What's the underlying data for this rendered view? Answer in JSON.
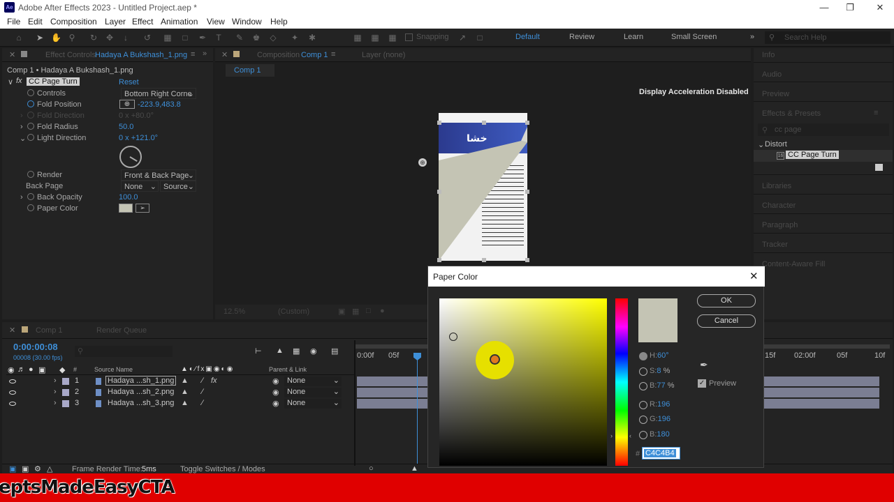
{
  "app": {
    "title": "Adobe After Effects 2023 - Untitled Project.aep *",
    "logo": "Ae"
  },
  "menu": [
    "File",
    "Edit",
    "Composition",
    "Layer",
    "Effect",
    "Animation",
    "View",
    "Window",
    "Help"
  ],
  "toolbar": {
    "snapping": "Snapping",
    "workspaces": [
      "Default",
      "Review",
      "Learn",
      "Small Screen"
    ],
    "search_placeholder": "Search Help"
  },
  "effect_controls": {
    "tab_prefix": "Effect Controls",
    "tab_name": "Hadaya A Bukshash_1.png",
    "breadcrumb": "Comp 1 • Hadaya A Bukshash_1.png",
    "effect": "CC Page Turn",
    "reset": "Reset",
    "props": [
      {
        "label": "Controls",
        "value": "Bottom Right Corne"
      },
      {
        "label": "Fold Position",
        "value": "-223.9,483.8"
      },
      {
        "label": "Fold Direction",
        "value": "0 x +80.0°"
      },
      {
        "label": "Fold Radius",
        "value": "50.0"
      },
      {
        "label": "Light Direction",
        "value": "0 x +121.0°"
      },
      {
        "label": "Render",
        "value": "Front & Back Page"
      },
      {
        "label": "Back Page",
        "value": "None",
        "value2": "Source"
      },
      {
        "label": "Back Opacity",
        "value": "100.0"
      },
      {
        "label": "Paper Color",
        "value": ""
      }
    ]
  },
  "composition": {
    "tab_prefix": "Composition",
    "tab_name": "Comp 1",
    "layer_tab": "Layer (none)",
    "subtab": "Comp 1",
    "notice": "Display Acceleration Disabled",
    "zoom": "12.5%",
    "resolution": "(Custom)"
  },
  "right_panel": {
    "items": [
      "Info",
      "Audio",
      "Preview",
      "Effects & Presets",
      "Libraries",
      "Character",
      "Paragraph",
      "Tracker",
      "Content-Aware Fill"
    ],
    "search": "cc page",
    "group": "Distort",
    "effect": "CC Page Turn"
  },
  "timeline": {
    "tab": "Comp 1",
    "render_queue": "Render Queue",
    "timecode": "0:00:00:08",
    "fps": "00008 (30.00 fps)",
    "col_source": "Source Name",
    "col_parent": "Parent & Link",
    "col_num": "#",
    "layers": [
      {
        "num": "1",
        "name": "Hadaya ...sh_1.png",
        "parent": "None"
      },
      {
        "num": "2",
        "name": "Hadaya ...sh_2.png",
        "parent": "None"
      },
      {
        "num": "3",
        "name": "Hadaya ...sh_3.png",
        "parent": "None"
      }
    ],
    "ruler": [
      "0:00f",
      "05f",
      "15f",
      "02:00f",
      "05f",
      "10f"
    ],
    "render_time_label": "Frame Render Time:",
    "render_time": "5ms",
    "toggle": "Toggle Switches / Modes"
  },
  "dialog": {
    "title": "Paper Color",
    "ok": "OK",
    "cancel": "Cancel",
    "h": "60",
    "s": "8",
    "b": "77",
    "r": "196",
    "g": "196",
    "b2": "180",
    "hex": "C4C4B4",
    "preview": "Preview",
    "h_label": "H:",
    "s_label": "S:",
    "b_label": "B:",
    "r_label": "R:",
    "g_label": "G:",
    "b2_label": "B:",
    "h_unit": "°",
    "s_unit": "%",
    "b_unit": "%"
  },
  "banner": {
    "text": "eptsMadeEasyCTA"
  },
  "colors": {
    "accent": "#3e8fd8",
    "swatch": "#c4c4b4",
    "banner": "#e00000"
  }
}
